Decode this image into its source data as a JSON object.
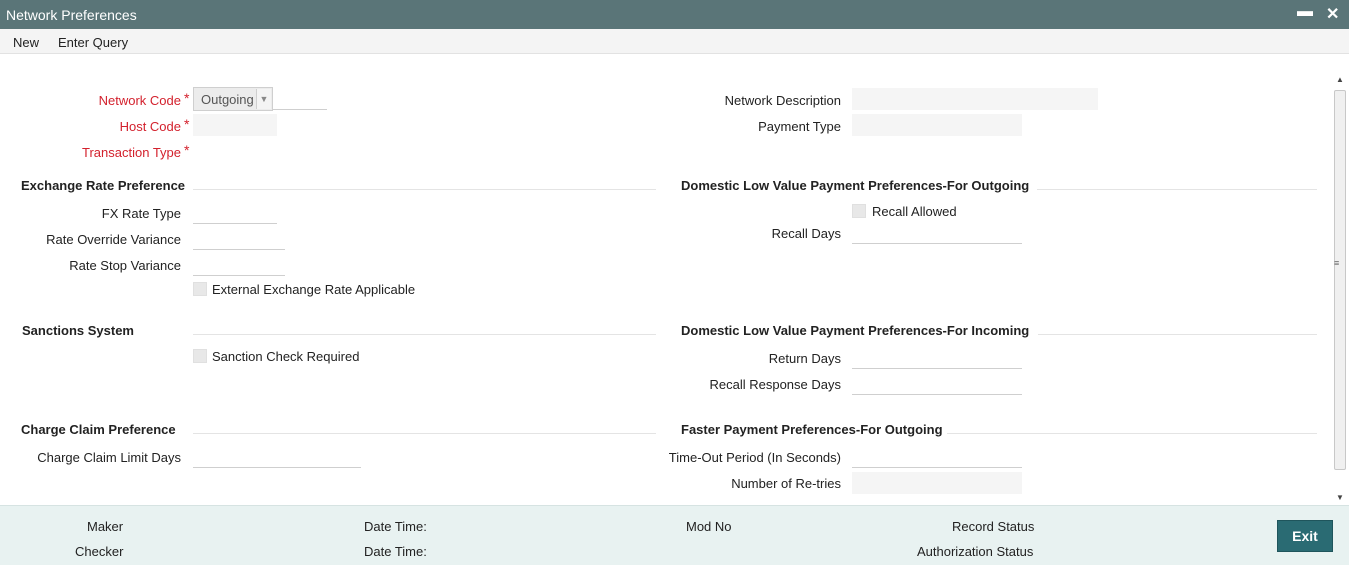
{
  "window": {
    "title": "Network Preferences",
    "minimize_glyph": "▬",
    "close_glyph": "✕"
  },
  "menu": {
    "new": "New",
    "enter_query": "Enter Query"
  },
  "main": {
    "network_code": {
      "label": "Network Code",
      "value": ""
    },
    "host_code": {
      "label": "Host Code",
      "value": ""
    },
    "transaction_type": {
      "label": "Transaction Type",
      "value": "Outgoing"
    },
    "network_description": {
      "label": "Network Description",
      "value": ""
    },
    "payment_type": {
      "label": "Payment Type",
      "value": ""
    },
    "required_marker": "*"
  },
  "exchange_rate": {
    "heading": "Exchange Rate Preference",
    "fx_rate_type": "FX Rate Type",
    "rate_override_variance": "Rate Override Variance",
    "rate_stop_variance": "Rate Stop Variance",
    "external_rate": {
      "label": "External Exchange Rate Applicable",
      "checked": false
    }
  },
  "domestic_outgoing": {
    "heading": "Domestic Low Value Payment Preferences-For Outgoing",
    "recall_allowed": {
      "label": "Recall Allowed",
      "checked": false
    },
    "recall_days": "Recall Days"
  },
  "sanctions": {
    "heading": "Sanctions System",
    "sanction_check": {
      "label": "Sanction Check Required",
      "checked": false
    }
  },
  "domestic_incoming": {
    "heading": "Domestic Low Value Payment Preferences-For Incoming",
    "return_days": "Return Days",
    "recall_response_days": "Recall Response Days"
  },
  "charge_claim": {
    "heading": "Charge Claim Preference",
    "limit_days": "Charge Claim Limit Days"
  },
  "faster_payment": {
    "heading": "Faster Payment Preferences-For Outgoing",
    "timeout": "Time-Out Period (In Seconds)",
    "retries": "Number of Re-tries"
  },
  "footer": {
    "maker": "Maker",
    "checker": "Checker",
    "date_time_1": "Date Time:",
    "date_time_2": "Date Time:",
    "mod_no": "Mod No",
    "record_status": "Record Status",
    "authorization_status": "Authorization Status",
    "exit": "Exit"
  },
  "colors": {
    "titlebar": "#5a7578",
    "required": "#d3212d",
    "footer_bg": "#e8f2f1",
    "exit_button": "#2a6b73"
  }
}
